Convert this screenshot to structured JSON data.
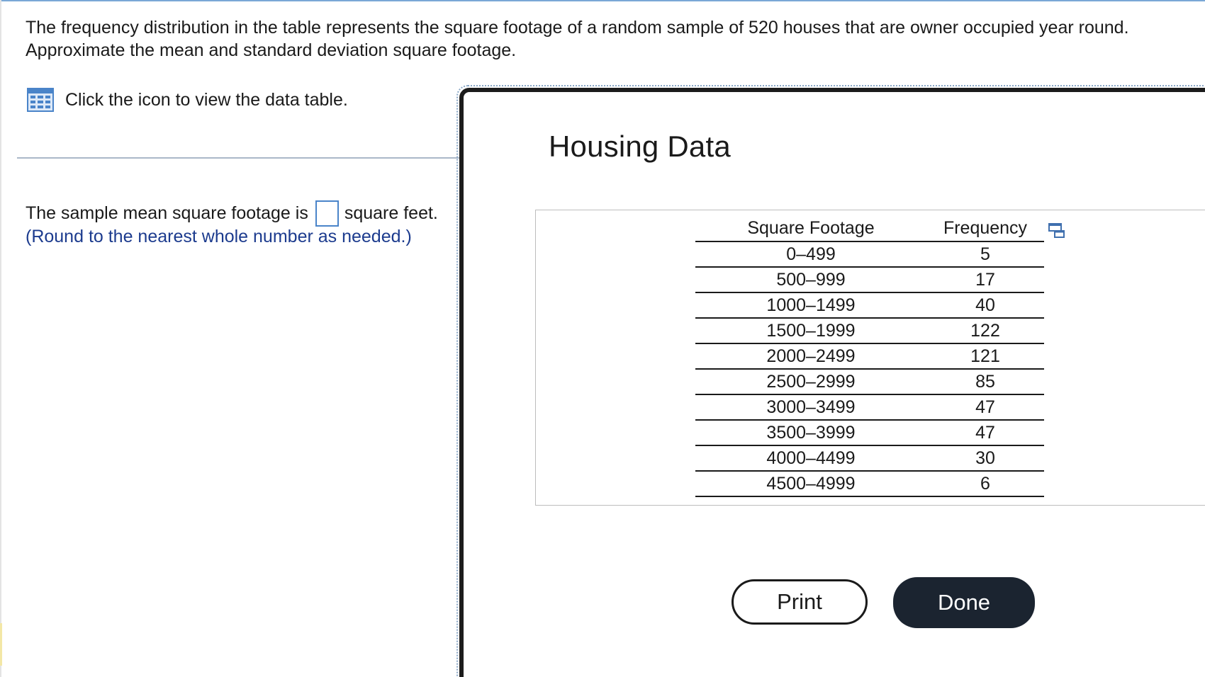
{
  "question": {
    "text_line1": "The frequency distribution in the table represents the square footage of a random sample of 520 houses that are owner occupied year round.",
    "text_line2": "Approximate the mean and standard deviation square footage."
  },
  "data_link": {
    "icon": "grid-table-icon",
    "label": "Click the icon to view the data table."
  },
  "answer": {
    "prefix": "The sample mean square footage is",
    "value": "",
    "suffix": "square feet.",
    "note": "(Round to the nearest whole number as needed.)"
  },
  "modal": {
    "title": "Housing Data",
    "table": {
      "headers": [
        "Square Footage",
        "Frequency"
      ],
      "rows": [
        [
          "0–499",
          "5"
        ],
        [
          "500–999",
          "17"
        ],
        [
          "1000–1499",
          "40"
        ],
        [
          "1500–1999",
          "122"
        ],
        [
          "2000–2499",
          "121"
        ],
        [
          "2500–2999",
          "85"
        ],
        [
          "3000–3499",
          "47"
        ],
        [
          "3500–3999",
          "47"
        ],
        [
          "4000–4499",
          "30"
        ],
        [
          "4500–4999",
          "6"
        ]
      ]
    },
    "copy_icon": "copy-to-clipboard-icon",
    "print_label": "Print",
    "done_label": "Done"
  },
  "colors": {
    "accent_blue": "#4a84c9",
    "note_blue": "#1c3b8e",
    "done_button_bg": "#1b2430"
  }
}
